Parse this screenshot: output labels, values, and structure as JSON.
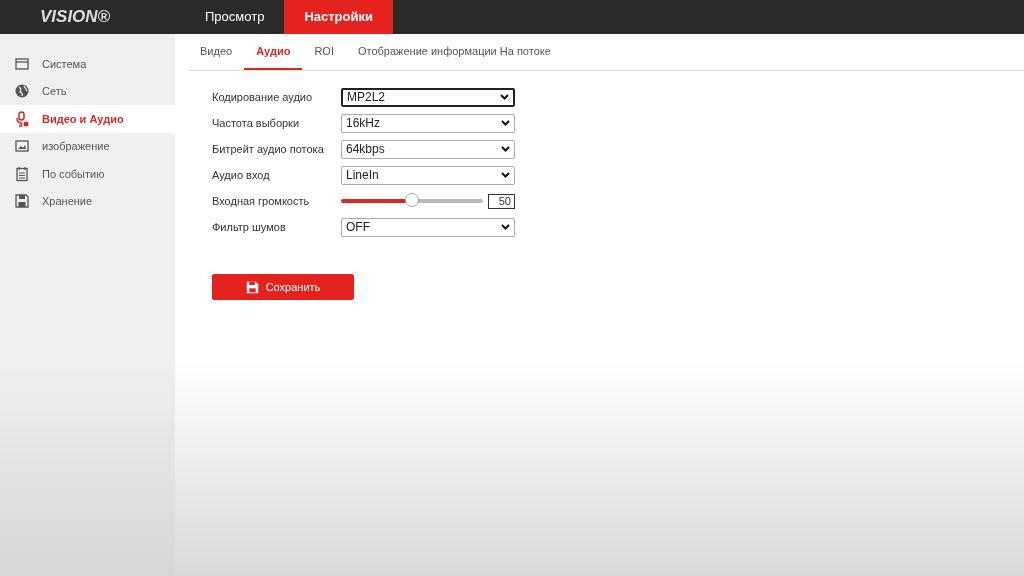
{
  "logo": "VISION®",
  "top_nav": [
    {
      "label": "Просмотр",
      "selected": false
    },
    {
      "label": "Настройки",
      "selected": true
    }
  ],
  "sidebar": {
    "items": [
      {
        "label": "Система",
        "kind": "window",
        "selected": false
      },
      {
        "label": "Сеть",
        "kind": "globe",
        "selected": false
      },
      {
        "label": "Видео и Аудио",
        "kind": "mic",
        "selected": true
      },
      {
        "label": "изображение",
        "kind": "image",
        "selected": false
      },
      {
        "label": "По событию",
        "kind": "calendar",
        "selected": false
      },
      {
        "label": "Хранение",
        "kind": "floppy",
        "selected": false
      }
    ]
  },
  "tabs": [
    {
      "label": "Видео",
      "selected": false
    },
    {
      "label": "Аудио",
      "selected": true
    },
    {
      "label": "ROI",
      "selected": false
    },
    {
      "label": "Отображение информации На потоке",
      "selected": false
    }
  ],
  "form": [
    {
      "kind": "select",
      "label": "Кодирование аудио",
      "value": "MP2L2",
      "focused": true
    },
    {
      "kind": "select",
      "label": "Частота выборки",
      "value": "16kHz",
      "focused": false
    },
    {
      "kind": "select",
      "label": "Битрейт аудио потока",
      "value": "64kbps",
      "focused": false
    },
    {
      "kind": "select",
      "label": "Аудио вход",
      "value": "LineIn",
      "focused": false
    },
    {
      "kind": "slider",
      "label": "Входная громкость",
      "level": 0.5,
      "value": "50"
    },
    {
      "kind": "select",
      "label": "Фильтр шумов",
      "value": "OFF",
      "focused": false
    }
  ],
  "save_button": "Сохранить"
}
